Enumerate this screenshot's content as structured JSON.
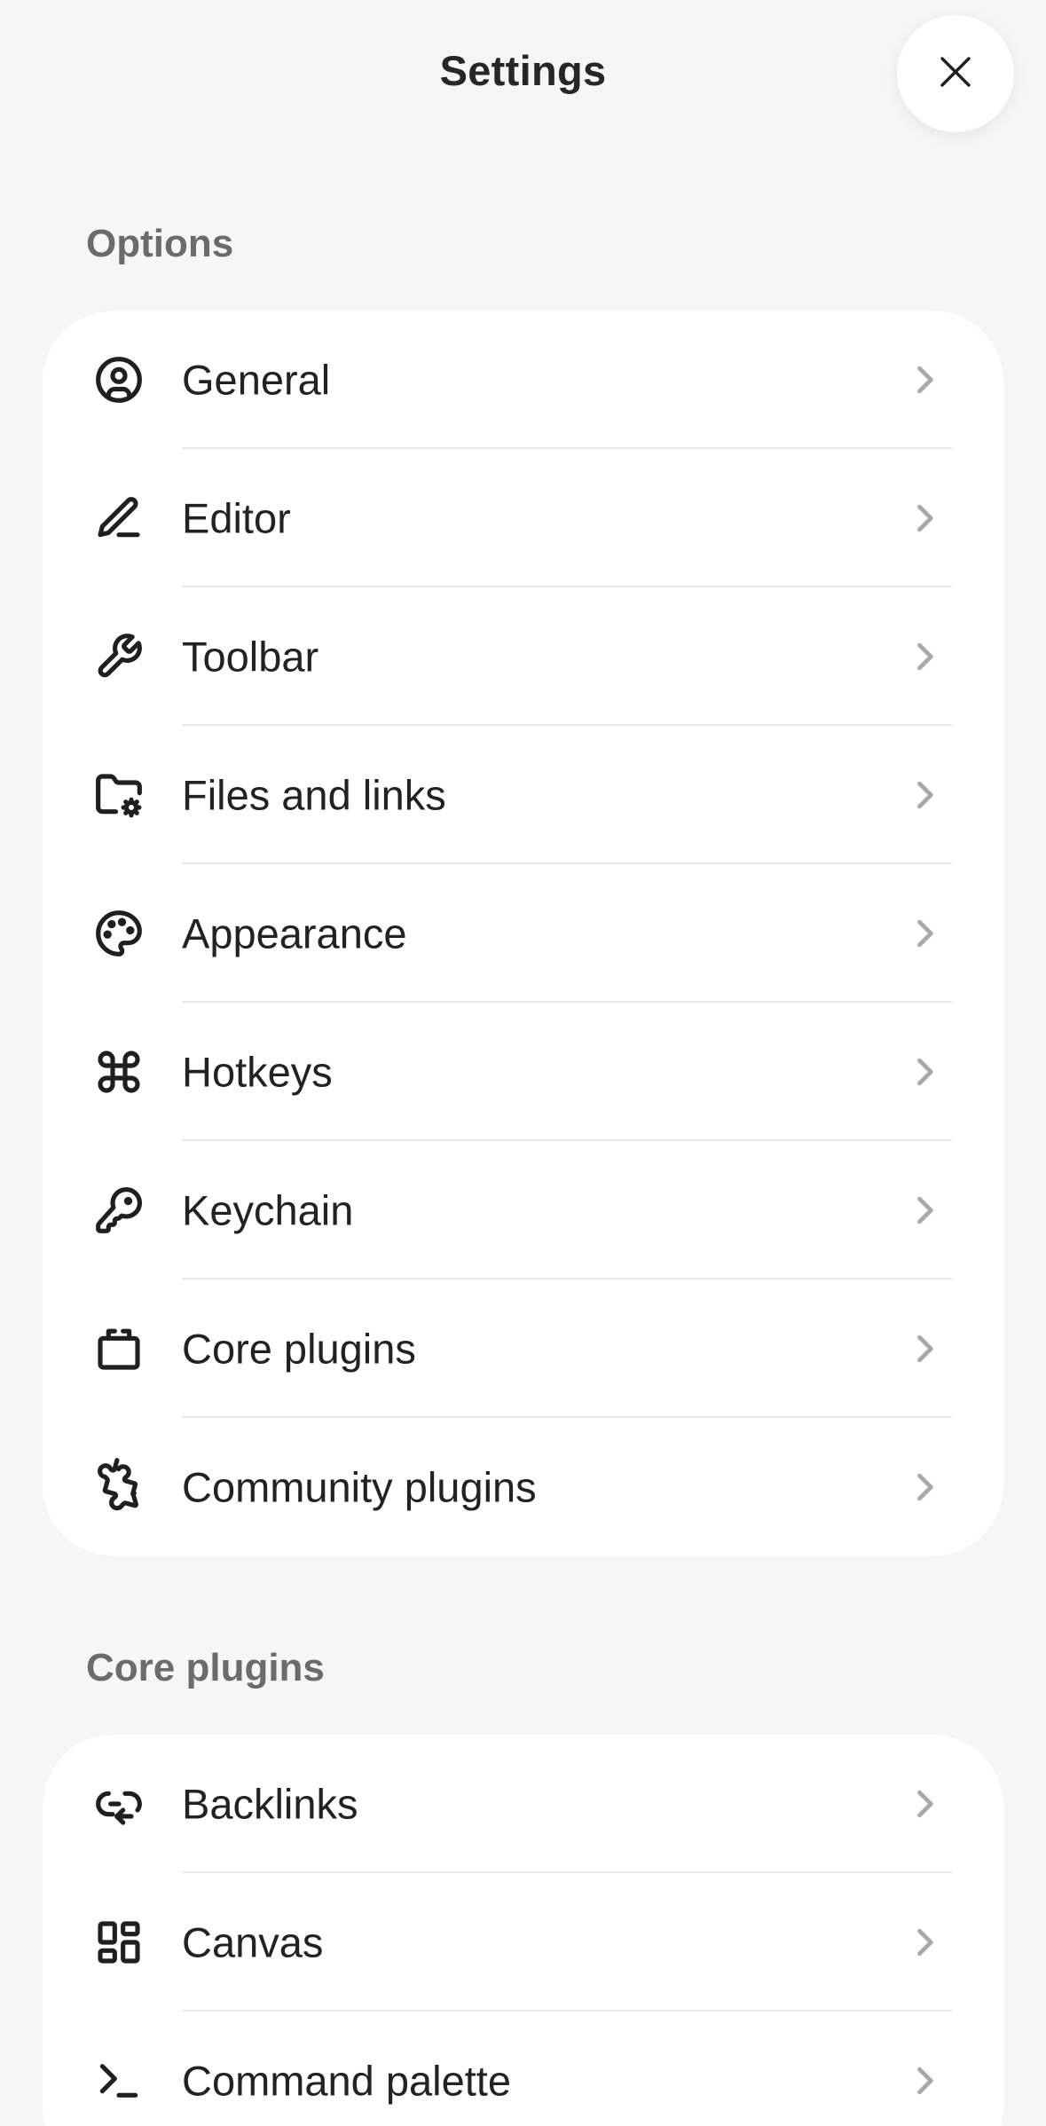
{
  "header": {
    "title": "Settings",
    "close_icon": "close-icon"
  },
  "sections": [
    {
      "label": "Options",
      "items": [
        {
          "label": "General",
          "icon": "user-circle-icon"
        },
        {
          "label": "Editor",
          "icon": "pencil-icon"
        },
        {
          "label": "Toolbar",
          "icon": "wrench-icon"
        },
        {
          "label": "Files and links",
          "icon": "folder-cog-icon"
        },
        {
          "label": "Appearance",
          "icon": "palette-icon"
        },
        {
          "label": "Hotkeys",
          "icon": "command-icon"
        },
        {
          "label": "Keychain",
          "icon": "key-icon"
        },
        {
          "label": "Core plugins",
          "icon": "box-icon"
        },
        {
          "label": "Community plugins",
          "icon": "puzzle-icon"
        }
      ]
    },
    {
      "label": "Core plugins",
      "items": [
        {
          "label": "Backlinks",
          "icon": "backlink-icon"
        },
        {
          "label": "Canvas",
          "icon": "layout-dashboard-icon"
        },
        {
          "label": "Command palette",
          "icon": "terminal-icon"
        }
      ]
    }
  ],
  "colors": {
    "background": "#f6f6f6",
    "card": "#ffffff",
    "text": "#222222",
    "section_label": "#6b6b6b",
    "chevron": "#a8a8a8",
    "divider": "#e8e8e8"
  }
}
